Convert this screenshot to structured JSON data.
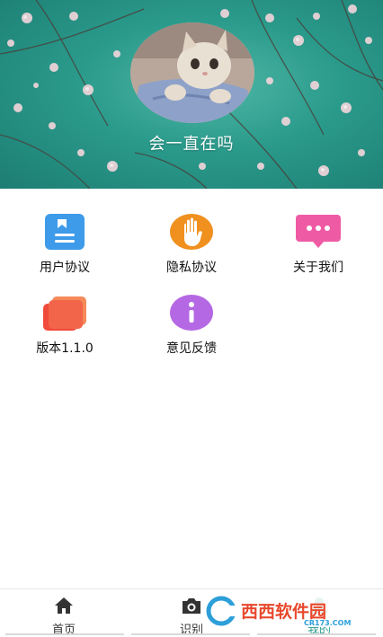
{
  "profile": {
    "username": "会一直在吗"
  },
  "menu": {
    "items": [
      {
        "label": "用户协议",
        "icon": "document-icon",
        "color": "#3d9be9"
      },
      {
        "label": "隐私协议",
        "icon": "hand-icon",
        "color": "#f0901f"
      },
      {
        "label": "关于我们",
        "icon": "chat-bubble-icon",
        "color": "#ef5aa4"
      },
      {
        "label": "版本1.1.0",
        "icon": "layers-icon",
        "color": "#f2654a"
      },
      {
        "label": "意见反馈",
        "icon": "info-icon",
        "color": "#b568e3"
      }
    ]
  },
  "nav": {
    "home": "首页",
    "scan": "识别",
    "mine": "我的"
  },
  "watermark": {
    "cn": "西西软件园",
    "en": "CR173.COM"
  },
  "colors": {
    "accent": "#2d9c8e",
    "header_bg": "#2a9a8b"
  }
}
